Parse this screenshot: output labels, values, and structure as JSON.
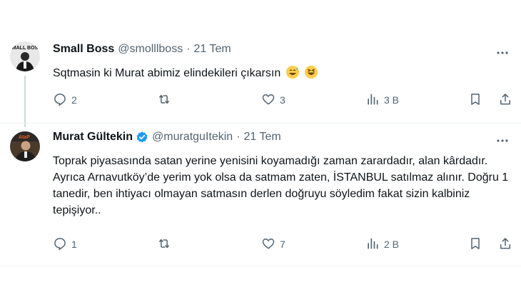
{
  "tweets": [
    {
      "name": "Small Boss",
      "handle": "@smolllboss",
      "separator": "·",
      "date": "21 Tem",
      "text": "Sqtmasin ki Murat abimiz elindekileri çıkarsın",
      "emojis": [
        "sweat-smile-emoji",
        "laughing-emoji"
      ],
      "verified": false,
      "actions": {
        "replies": "2",
        "retweets": "",
        "likes": "3",
        "views": "3 B"
      }
    },
    {
      "name": "Murat Gültekin",
      "handle": "@muratguItekin",
      "separator": "·",
      "date": "21 Tem",
      "text": "Toprak piyasasında satan yerine yenisini koyamadığı zaman zarardadır, alan kârdadır. Ayrıca Arnavutköy’de yerim yok olsa da satmam zaten, İSTANBUL satılmaz alınır. Doğru 1 tanedir, ben ihtiyacı olmayan satmasın derlen doğruyu söyledim fakat sizin kalbiniz tepişiyor..",
      "verified": true,
      "actions": {
        "replies": "1",
        "retweets": "",
        "likes": "7",
        "views": "2 B"
      }
    }
  ],
  "colors": {
    "text": "#0f1419",
    "secondary": "#536471",
    "verified": "#1d9bf0",
    "divider": "#eff3f4"
  }
}
